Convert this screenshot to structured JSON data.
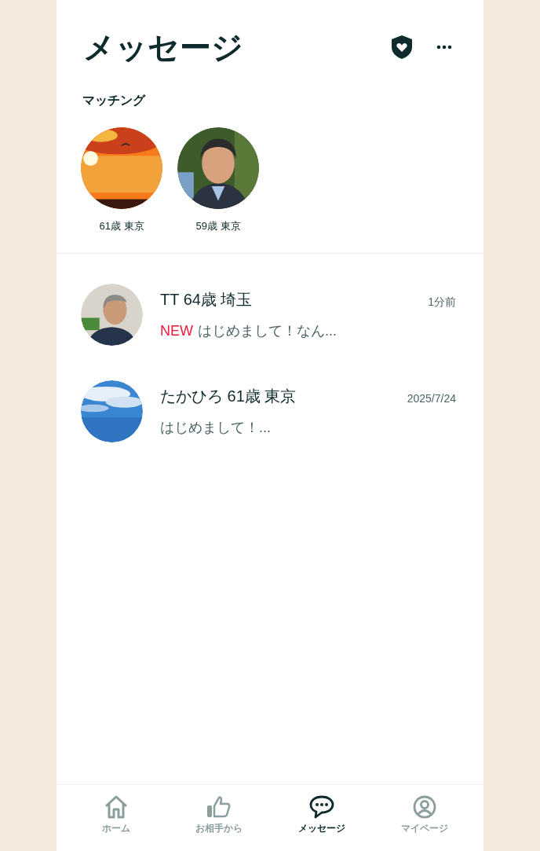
{
  "header": {
    "title": "メッセージ"
  },
  "matching": {
    "title": "マッチング",
    "profiles": [
      {
        "label": "61歳 東京"
      },
      {
        "label": "59歳 東京"
      }
    ]
  },
  "messages": [
    {
      "name": "TT 64歳 埼玉",
      "time": "1分前",
      "badge": "NEW",
      "preview": "はじめまして！なん..."
    },
    {
      "name": "たかひろ 61歳 東京",
      "time": "2025/7/24",
      "preview": "はじめまして！..."
    }
  ],
  "tab_bar": [
    {
      "kind": "home",
      "label": "ホーム",
      "selected": false
    },
    {
      "kind": "like",
      "label": "お相手から",
      "selected": false
    },
    {
      "kind": "message",
      "label": "メッセージ",
      "selected": true
    },
    {
      "kind": "profile",
      "label": "マイページ",
      "selected": false
    }
  ]
}
